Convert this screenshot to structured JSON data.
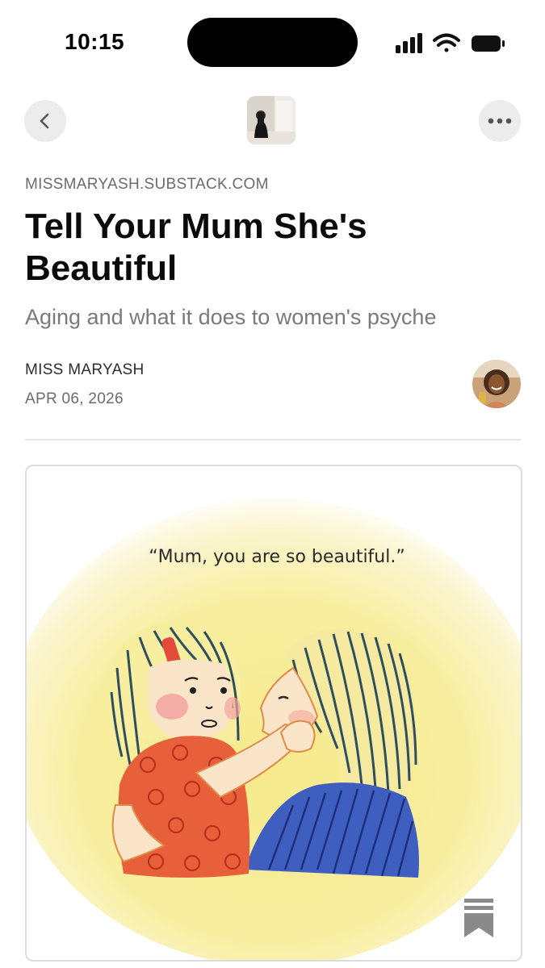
{
  "status_bar": {
    "time": "10:15",
    "icons": [
      "cellular-signal-icon",
      "wifi-icon",
      "battery-icon"
    ]
  },
  "nav": {
    "back_icon": "chevron-left-icon",
    "more_icon": "ellipsis-icon",
    "publication_avatar": "publication-avatar"
  },
  "article": {
    "domain": "MISSMARYASH.SUBSTACK.COM",
    "title": "Tell Your Mum She's Beautiful",
    "subtitle": "Aging and what it does to women's psyche",
    "author": "MISS MARYASH",
    "date": "APR 06, 2026"
  },
  "image": {
    "caption": "“Mum, you are so beautiful.”",
    "bookmark_icon": "bookmark-icon"
  },
  "colors": {
    "background": "#ffffff",
    "title": "#0b0b0b",
    "muted_text": "#7a7a7a",
    "nav_button_bg": "#ececec",
    "illustration_yellow": "#f7ec9a",
    "child_dress": "#e8603a",
    "mother_shirt": "#3f5fc0"
  }
}
